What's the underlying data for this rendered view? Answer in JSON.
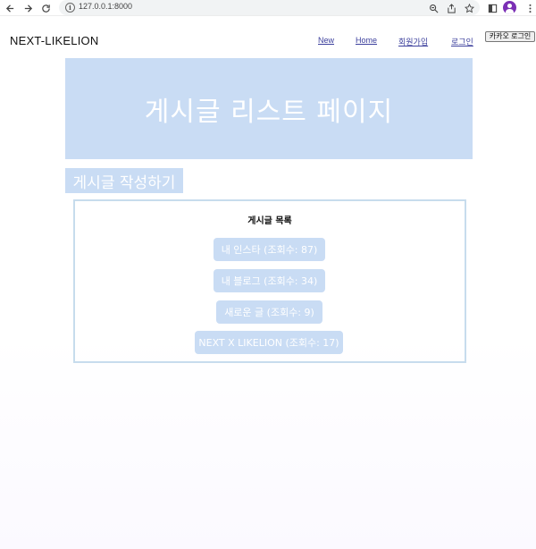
{
  "browser": {
    "url": "127.0.0.1:8000"
  },
  "header": {
    "brand": "NEXT-LIKELION",
    "nav": [
      "New",
      "Home",
      "회원가입",
      "로그인"
    ],
    "kakao_login": "카카오 로그인"
  },
  "hero": {
    "title": "게시글 리스트 페이지"
  },
  "write_button": "게시글 작성하기",
  "list": {
    "title": "게시글 목록",
    "posts": [
      "내 인스타 (조회수: 87)",
      "내 블로그 (조회수: 34)",
      "새로운 글 (조회수: 9)",
      "NEXT X LIKELION (조회수: 17)"
    ]
  },
  "colors": {
    "accent": "#c9dcf4",
    "border": "#c7dced",
    "link": "#3b3f9c"
  }
}
